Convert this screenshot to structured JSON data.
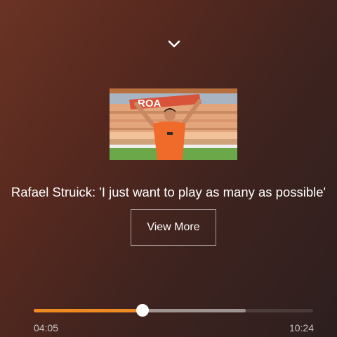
{
  "player": {
    "collapse_icon": "chevron-down-icon",
    "thumbnail_banner_text": "ROA",
    "headline": "Rafael Struick: 'I just want to play as many as possible'",
    "view_more_label": "View More",
    "current_time": "04:05",
    "total_time": "10:24",
    "progress_fraction": 0.39,
    "buffered_fraction": 0.76,
    "accent_color": "#ee8a22"
  }
}
